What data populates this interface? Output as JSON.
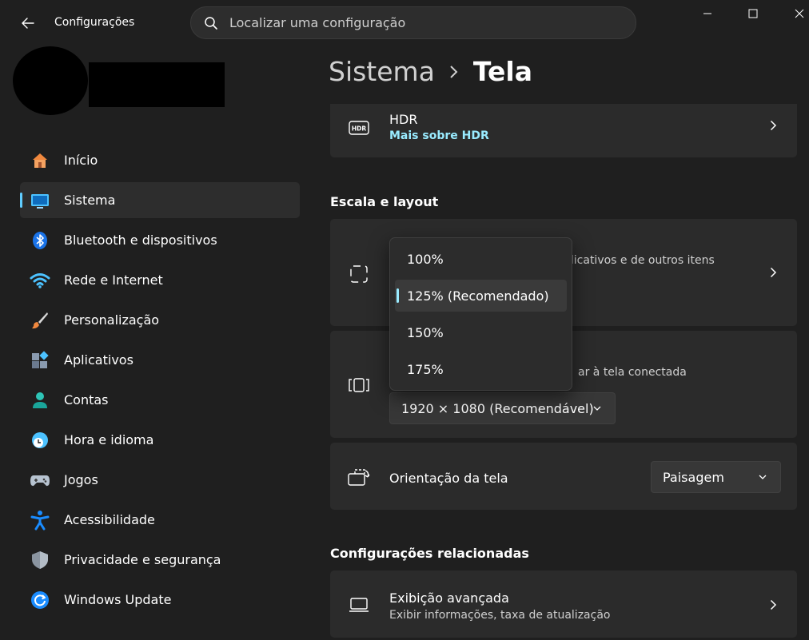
{
  "window": {
    "title": "Configurações",
    "controls": [
      "minimize-icon",
      "maximize-icon",
      "close-icon"
    ]
  },
  "search": {
    "placeholder": "Localizar uma configuração"
  },
  "sidebar": {
    "items": [
      {
        "label": "Início",
        "icon": "home-icon"
      },
      {
        "label": "Sistema",
        "icon": "monitor-icon",
        "active": true
      },
      {
        "label": "Bluetooth e dispositivos",
        "icon": "bluetooth-icon"
      },
      {
        "label": "Rede e Internet",
        "icon": "wifi-icon"
      },
      {
        "label": "Personalização",
        "icon": "paintbrush-icon"
      },
      {
        "label": "Aplicativos",
        "icon": "apps-icon"
      },
      {
        "label": "Contas",
        "icon": "person-icon"
      },
      {
        "label": "Hora e idioma",
        "icon": "clock-globe-icon"
      },
      {
        "label": "Jogos",
        "icon": "gamepad-icon"
      },
      {
        "label": "Acessibilidade",
        "icon": "accessibility-icon"
      },
      {
        "label": "Privacidade e segurança",
        "icon": "shield-icon"
      },
      {
        "label": "Windows Update",
        "icon": "update-icon"
      }
    ]
  },
  "header": {
    "parent": "Sistema",
    "current": "Tela"
  },
  "hdr": {
    "title": "HDR",
    "link": "Mais sobre HDR"
  },
  "scale_section": {
    "heading": "Escala e layout"
  },
  "scale_card": {
    "subtitle_partial": "plicativos e de outros itens"
  },
  "resolution_card": {
    "subtitle_partial": "ar à tela conectada",
    "value": "1920 × 1080 (Recomendável)"
  },
  "orientation_card": {
    "title": "Orientação da tela",
    "value": "Paisagem"
  },
  "scale_dropdown": {
    "options": [
      "100%",
      "125% (Recomendado)",
      "150%",
      "175%"
    ],
    "selected_index": 1
  },
  "related_section": {
    "heading": "Configurações relacionadas"
  },
  "advanced_card": {
    "title": "Exibição avançada",
    "subtitle": "Exibir informações, taxa de atualização"
  },
  "colors": {
    "accent": "#60cdff",
    "link": "#99ebff",
    "background": "#1f1f1f",
    "card": "#2b2b2b"
  }
}
